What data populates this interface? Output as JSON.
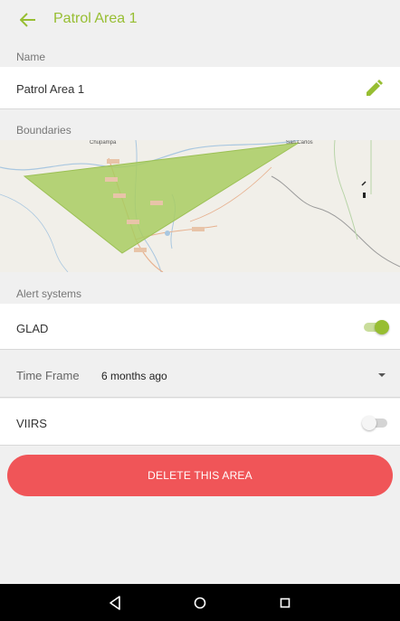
{
  "header": {
    "title": "Patrol Area 1",
    "back_icon": "arrow-left-icon"
  },
  "colors": {
    "accent": "#97be32",
    "danger": "#f05558",
    "background": "#f0f0f0"
  },
  "name_section": {
    "label": "Name",
    "value": "Patrol Area 1",
    "edit_icon": "pencil-icon"
  },
  "boundaries_section": {
    "label": "Boundaries",
    "map_labels": [
      "Chupampa",
      "San Carlos"
    ]
  },
  "alerts_section": {
    "label": "Alert systems",
    "glad": {
      "label": "GLAD",
      "enabled": true
    },
    "time_frame": {
      "label": "Time Frame",
      "value": "6 months ago"
    },
    "viirs": {
      "label": "VIIRS",
      "enabled": false
    }
  },
  "delete_button": {
    "label": "DELETE THIS AREA"
  },
  "nav_bar": {
    "back": "triangle-back-icon",
    "home": "circle-home-icon",
    "recents": "square-recents-icon"
  }
}
